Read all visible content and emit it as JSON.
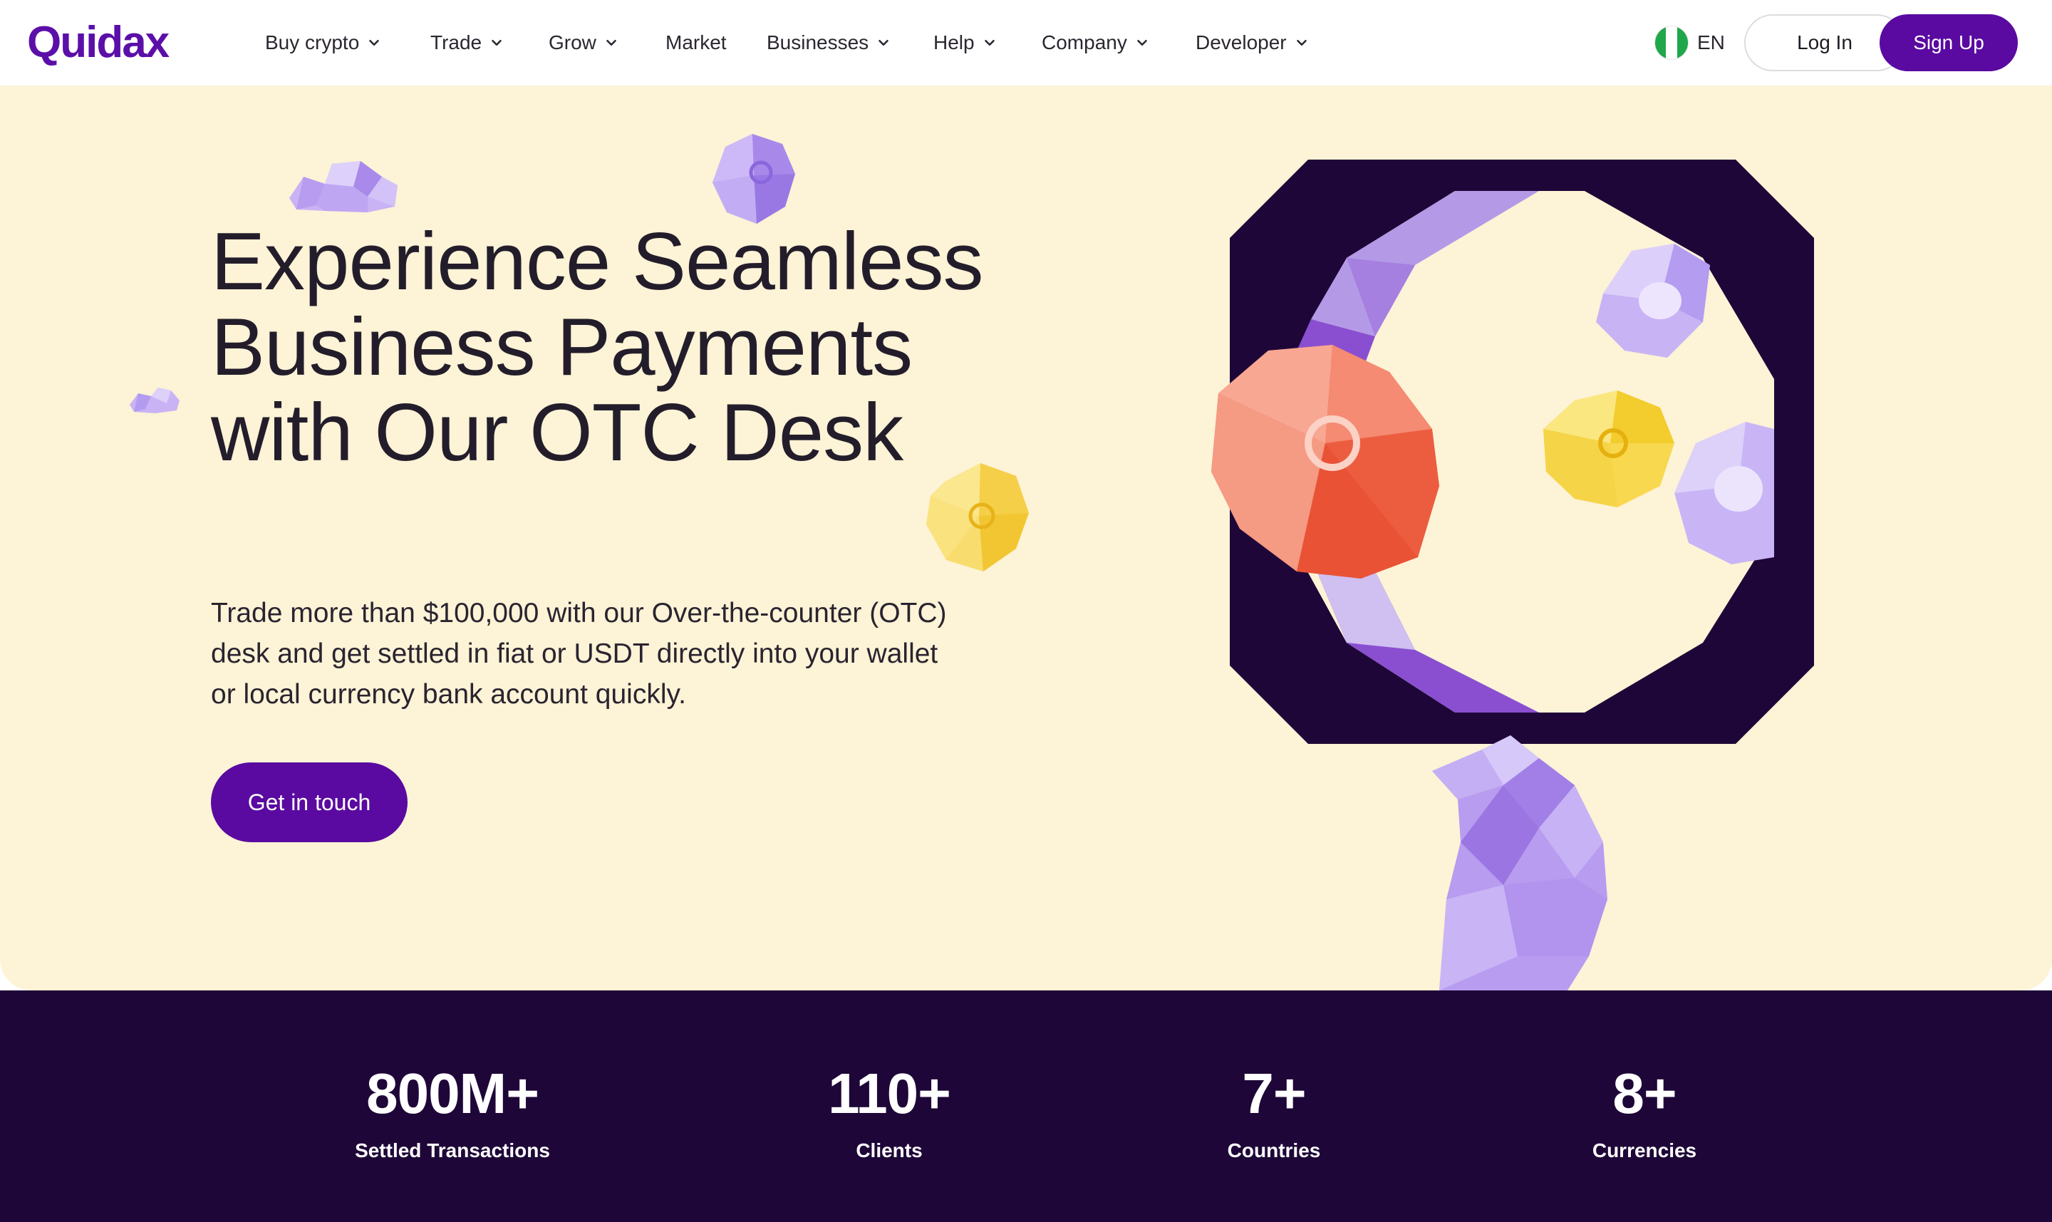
{
  "brand": {
    "logo_text": "Quidax",
    "primary_color": "#5a0aa0",
    "dark_color": "#1e0738",
    "hero_bg": "#fdf3d6"
  },
  "nav": {
    "items": [
      {
        "label": "Buy crypto",
        "has_dropdown": true
      },
      {
        "label": "Trade",
        "has_dropdown": true
      },
      {
        "label": "Grow",
        "has_dropdown": true
      },
      {
        "label": "Market",
        "has_dropdown": false
      },
      {
        "label": "Businesses",
        "has_dropdown": true
      },
      {
        "label": "Help",
        "has_dropdown": true
      },
      {
        "label": "Company",
        "has_dropdown": true
      },
      {
        "label": "Developer",
        "has_dropdown": true
      }
    ],
    "language": "EN",
    "login_label": "Log In",
    "signup_label": "Sign Up"
  },
  "hero": {
    "title": "Experience Seamless Business Payments with Our OTC Desk",
    "subtitle": "Trade more than $100,000 with our Over-the-counter (OTC) desk and get settled in fiat or USDT directly into your wallet or local currency bank account quickly.",
    "cta_label": "Get in touch"
  },
  "stats": [
    {
      "value": "800M+",
      "label": "Settled Transactions"
    },
    {
      "value": "110+",
      "label": "Clients"
    },
    {
      "value": "7+",
      "label": "Countries"
    },
    {
      "value": "8+",
      "label": "Currencies"
    }
  ],
  "icons": [
    "chevron-down-icon",
    "nigeria-flag-icon",
    "coin-icon",
    "cloud-icon",
    "magnifier-illustration"
  ]
}
